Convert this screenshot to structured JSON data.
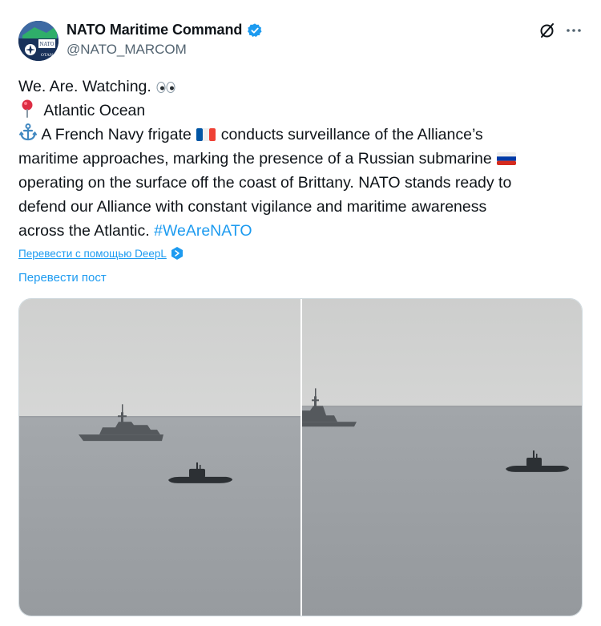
{
  "author": {
    "display_name": "NATO Maritime Command",
    "handle": "@NATO_MARCOM",
    "avatar_text_top": "NATO",
    "avatar_text_bottom": "OTAN"
  },
  "post": {
    "line1": "We. Are. Watching.",
    "line2": "Atlantic Ocean",
    "line3a": "A French Navy frigate",
    "line3b": "conducts surveillance of the Alliance’s",
    "line4": "maritime approaches, marking the presence of a Russian submarine",
    "line5": "operating on the surface off the coast of Brittany. NATO stands ready to",
    "line6": "defend our Alliance with constant vigilance and maritime awareness",
    "line7": "across the Atlantic.",
    "hashtag": "#WeAreNATO"
  },
  "translation": {
    "deepl_link": "Перевести с помощью DeepL",
    "translate_post": "Перевести пост"
  },
  "colors": {
    "link": "#1d9bf0",
    "text": "#0f1419",
    "secondary": "#536471",
    "sky": "#d2d3d2",
    "sea": "#9da1a5"
  },
  "icons": [
    "verified-badge-icon",
    "grok-icon",
    "more-icon",
    "eyes-emoji-icon",
    "pin-emoji-icon",
    "anchor-emoji-icon",
    "france-flag-icon",
    "russia-flag-icon",
    "deepl-icon"
  ]
}
